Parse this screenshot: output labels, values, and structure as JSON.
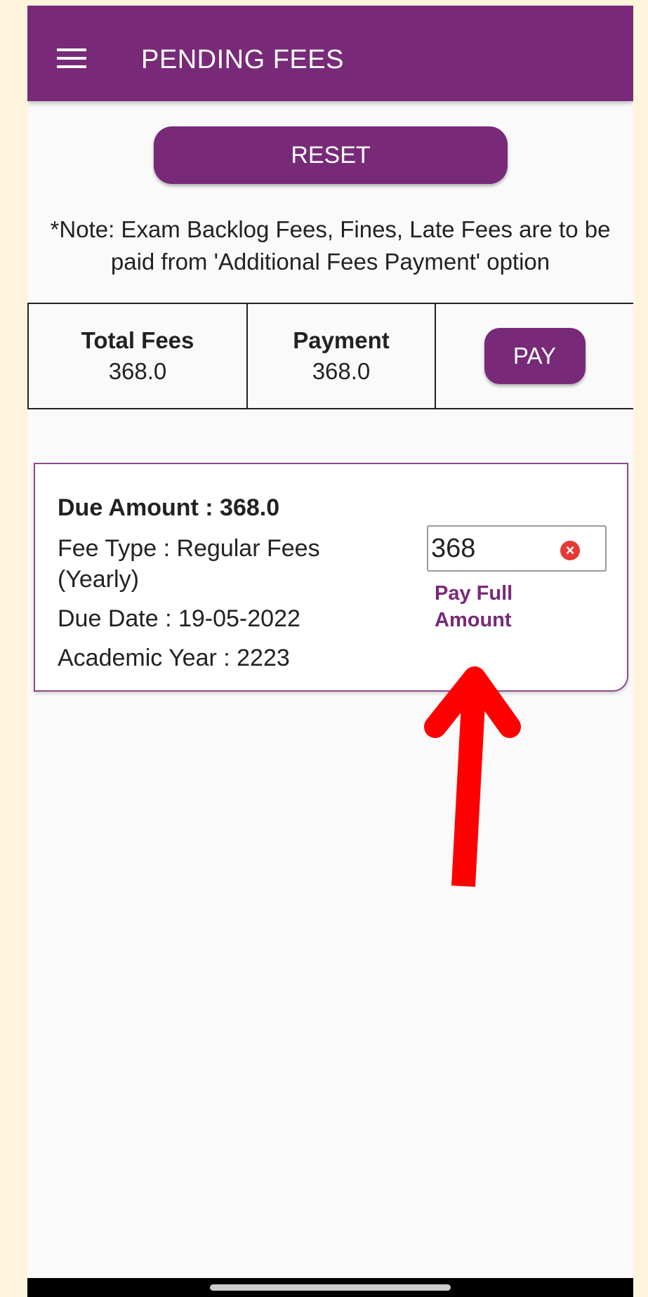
{
  "app_bar": {
    "title": "PENDING FEES",
    "menu_icon": "hamburger-menu-icon",
    "color": "#782a78"
  },
  "reset_button": {
    "label": "RESET"
  },
  "note": "*Note: Exam Backlog Fees, Fines, Late Fees are to be paid from 'Additional Fees Payment' option",
  "totals": {
    "total_fees_label": "Total Fees",
    "total_fees_value": "368.0",
    "payment_label": "Payment",
    "payment_value": "368.0",
    "pay_button_label": "PAY"
  },
  "fee_card": {
    "due_amount": "Due Amount : 368.0",
    "fee_type": "Fee Type : Regular Fees (Yearly)",
    "due_date": "Due Date : 19-05-2022",
    "academic_year": "Academic Year : 2223",
    "amount_input_value": "368",
    "clear_icon": "clear-x-icon",
    "pay_full_label": "Pay Full Amount"
  },
  "annotation": {
    "arrow_color": "#ff0000"
  }
}
